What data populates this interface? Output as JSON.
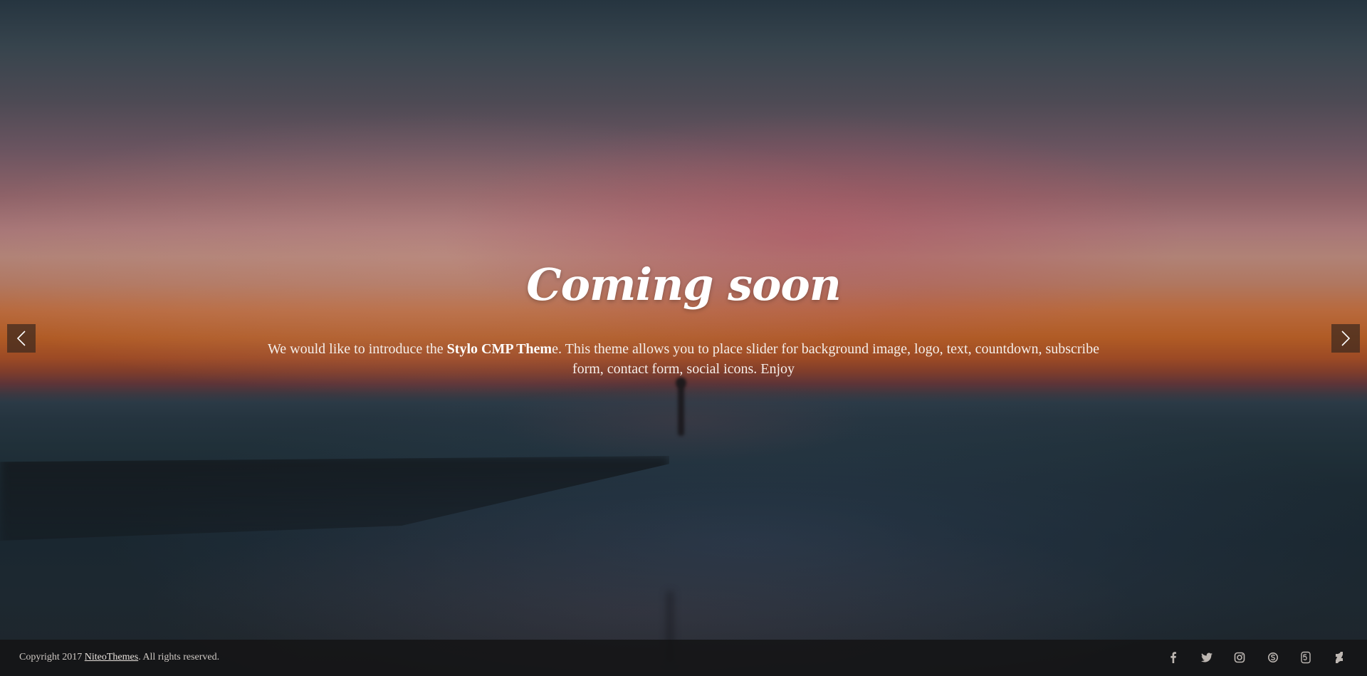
{
  "hero": {
    "title": "Coming soon",
    "intro_before": "We would like to introduce the ",
    "intro_strong": "Stylo CMP Them",
    "intro_after": "e.  This theme allows you to place slider for background image, logo, text, countdown, subscribe form, contact form, social icons. Enjoy"
  },
  "slider": {
    "prev_icon": "chevron-left-icon",
    "next_icon": "chevron-right-icon"
  },
  "footer": {
    "copyright_prefix": "Copyright 2017 ",
    "copyright_link": "NiteoThemes",
    "copyright_suffix": ". All rights reserved.",
    "social_icons": [
      "facebook-icon",
      "twitter-icon",
      "instagram-icon",
      "skype-icon",
      "500px-icon",
      "deviantart-icon"
    ]
  },
  "colors": {
    "text": "#ffffff",
    "footer_bg": "#141416",
    "arrow_bg": "#3c281e"
  }
}
